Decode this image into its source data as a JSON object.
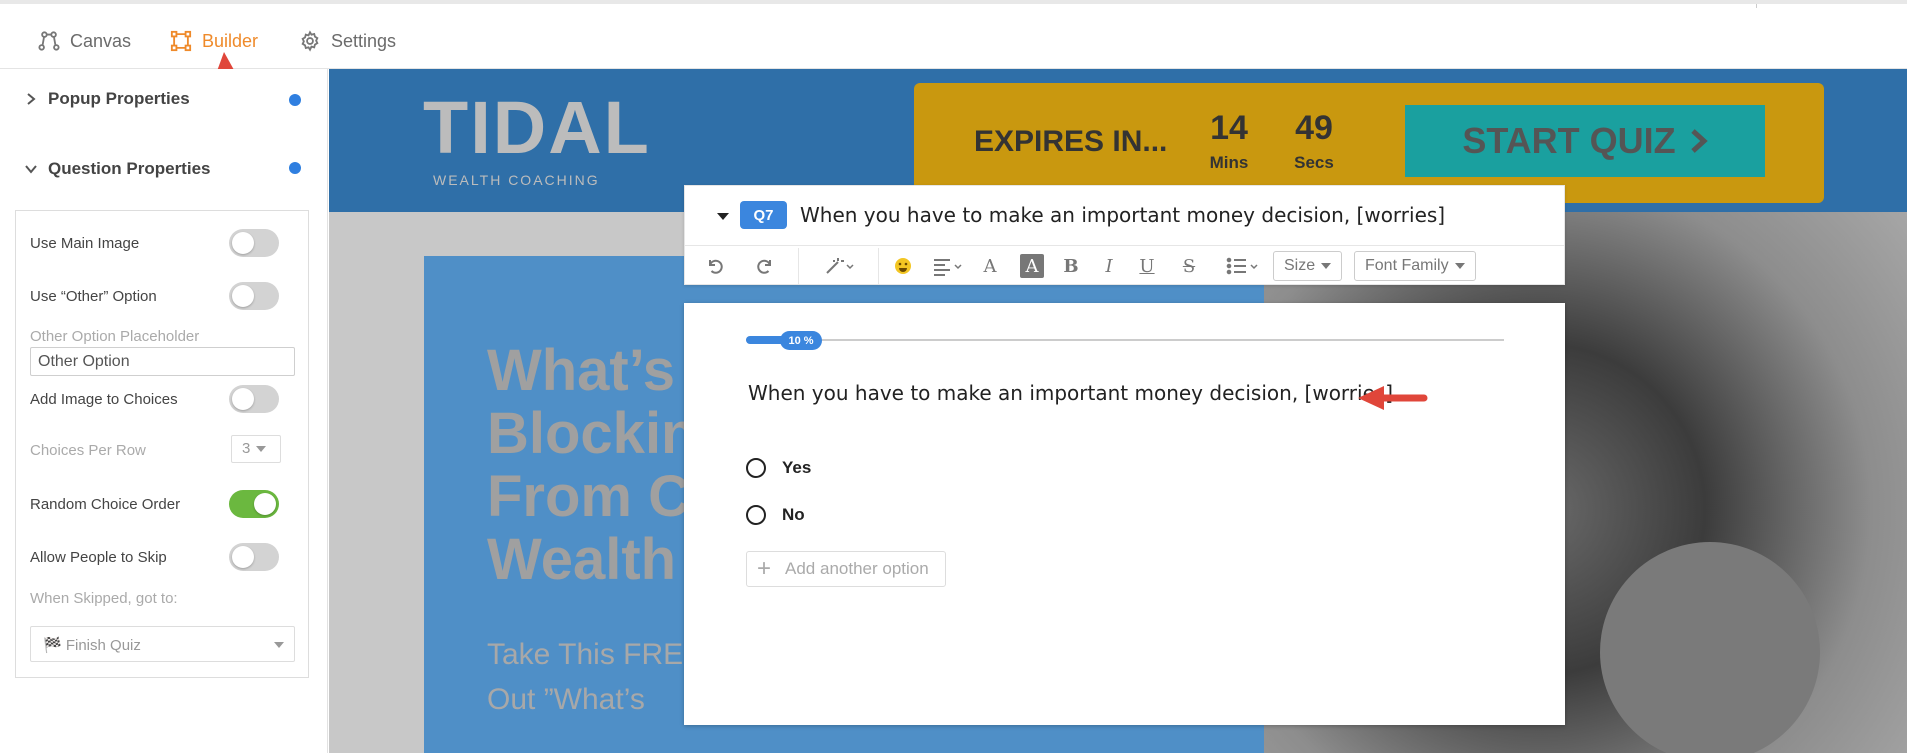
{
  "nav": {
    "tabs": [
      {
        "label": "Canvas",
        "icon": "canvas-icon"
      },
      {
        "label": "Builder",
        "icon": "builder-icon",
        "active": true
      },
      {
        "label": "Settings",
        "icon": "gear-icon"
      }
    ],
    "active_color": "#ef8a2a"
  },
  "sidebar": {
    "popup_properties": "Popup Properties",
    "question_properties": "Question Properties",
    "use_main_image": {
      "label": "Use Main Image",
      "on": false
    },
    "use_other_option": {
      "label": "Use “Other” Option",
      "on": false
    },
    "other_placeholder_label": "Other Option Placeholder",
    "other_placeholder_value": "Other Option",
    "add_image_to_choices": {
      "label": "Add Image to Choices",
      "on": false
    },
    "choices_per_row": {
      "label": "Choices Per Row",
      "value": "3"
    },
    "random_choice_order": {
      "label": "Random Choice Order",
      "on": true
    },
    "allow_skip": {
      "label": "Allow People to Skip",
      "on": false
    },
    "when_skipped_label": "When Skipped, got to:",
    "when_skipped_value": "🏁 Finish Quiz"
  },
  "canvas": {
    "logo": "TIDAL",
    "logo_sub": "WEALTH COACHING",
    "expires_label": "EXPIRES IN...",
    "timer": {
      "mins": "14",
      "mins_label": "Mins",
      "secs": "49",
      "secs_label": "Secs"
    },
    "start_button": "START QUIZ",
    "headline": "What’s\nBlockin\nFrom C\nWealth",
    "subtext": "Take This FRE\nOut ”What’s"
  },
  "question": {
    "badge": "Q7",
    "title": "When you have to make an important money decision, [worries]",
    "toolbar": {
      "size": "Size",
      "font_family": "Font Family"
    },
    "progress_label": "10 %",
    "progress": 0.1,
    "text": "When you have to make an important money decision, [worries]",
    "choices": [
      "Yes",
      "No"
    ],
    "add_option": "Add another option"
  }
}
